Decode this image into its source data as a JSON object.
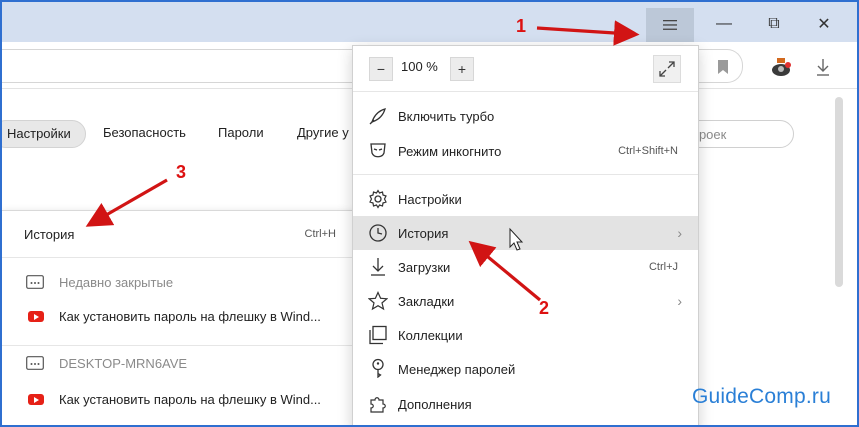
{
  "window": {
    "menu_icon": "hamburger-icon",
    "minimize": "—",
    "maximize": "⧉",
    "close": "✕"
  },
  "toolbar": {
    "bookmark_icon": "bookmark-icon",
    "extension_icon": "extension-icon",
    "download_icon": "download-icon"
  },
  "settings_nav": {
    "tabs": [
      "Настройки",
      "Безопасность",
      "Пароли",
      "Другие у"
    ],
    "search_placeholder": "троек"
  },
  "history_panel": {
    "title": "История",
    "title_shortcut": "Ctrl+H",
    "rows": [
      {
        "label": "Недавно закрытые",
        "icon": "folder-dots-icon"
      },
      {
        "label": "Как установить пароль на флешку в Wind...",
        "icon": "youtube-icon"
      },
      {
        "label": "DESKTOP-MRN6AVE",
        "icon": "folder-dots-icon"
      },
      {
        "label": "Как установить пароль на флешку в Wind...",
        "icon": "youtube-icon"
      }
    ]
  },
  "main_menu": {
    "zoom": {
      "minus": "−",
      "value": "100 %",
      "plus": "+"
    },
    "items": [
      {
        "label": "Включить турбо",
        "icon": "rocket-icon",
        "shortcut": ""
      },
      {
        "label": "Режим инкогнито",
        "icon": "incognito-mask-icon",
        "shortcut": "Ctrl+Shift+N"
      },
      {
        "label": "Настройки",
        "icon": "gear-icon",
        "shortcut": ""
      },
      {
        "label": "История",
        "icon": "clock-icon",
        "shortcut": "",
        "submenu": true
      },
      {
        "label": "Загрузки",
        "icon": "download-icon",
        "shortcut": "Ctrl+J"
      },
      {
        "label": "Закладки",
        "icon": "star-icon",
        "shortcut": "",
        "submenu": true
      },
      {
        "label": "Коллекции",
        "icon": "collections-icon",
        "shortcut": ""
      },
      {
        "label": "Менеджер паролей",
        "icon": "key-icon",
        "shortcut": ""
      },
      {
        "label": "Дополнения",
        "icon": "puzzle-icon",
        "shortcut": ""
      }
    ],
    "chevron": "›"
  },
  "annotations": {
    "n1": "1",
    "n2": "2",
    "n3": "3",
    "arrow_color": "#d11414"
  },
  "watermark": {
    "text": "GuideComp",
    "suffix": ".ru"
  },
  "colors": {
    "titlebar": "#d4dff0",
    "frame": "#2f6fd0",
    "hover": "#e3e3e3"
  }
}
